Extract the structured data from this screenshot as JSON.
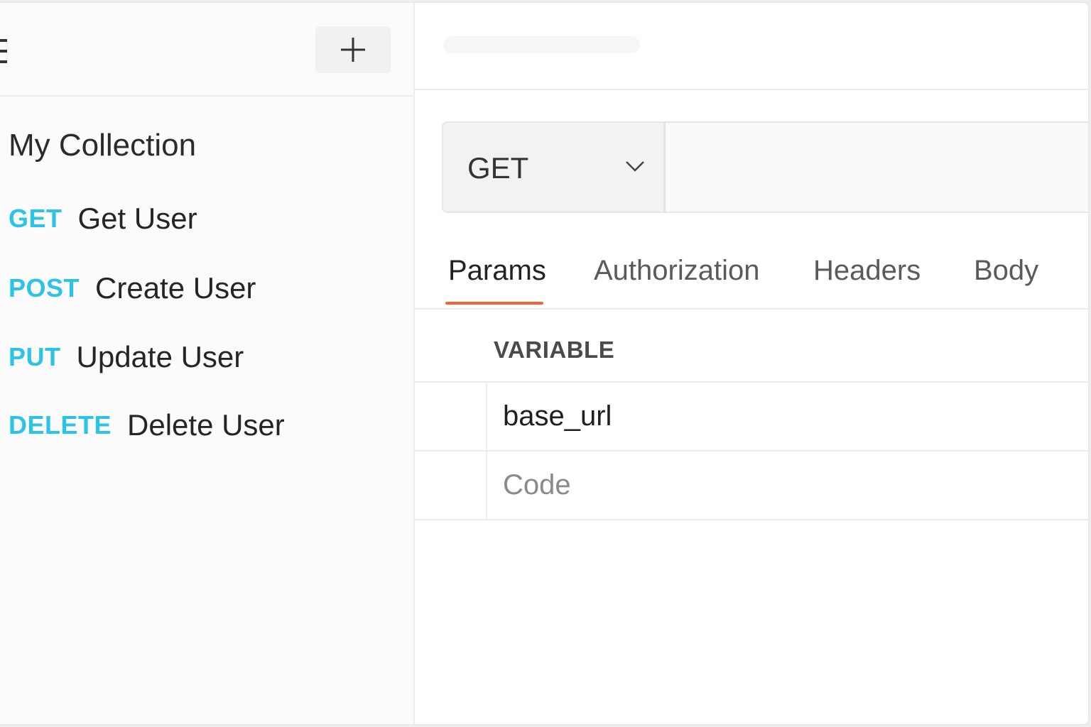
{
  "sidebar": {
    "add_icon": "plus-icon",
    "menu_icon": "hamburger-icon",
    "collection_title": "My Collection",
    "requests": [
      {
        "method": "GET",
        "name": "Get User"
      },
      {
        "method": "POST",
        "name": "Create User"
      },
      {
        "method": "PUT",
        "name": "Update User"
      },
      {
        "method": "DELETE",
        "name": "Delete User"
      }
    ],
    "method_color": "#2cc4e6"
  },
  "request": {
    "method": "GET",
    "url": "",
    "tabs": [
      "Params",
      "Authorization",
      "Headers",
      "Body"
    ],
    "active_tab": "Params",
    "active_tab_color": "#f0663a"
  },
  "variables_table": {
    "header": "VARIABLE",
    "rows": [
      {
        "value": "base_url",
        "placeholder": ""
      },
      {
        "value": "",
        "placeholder": "Code"
      }
    ]
  }
}
